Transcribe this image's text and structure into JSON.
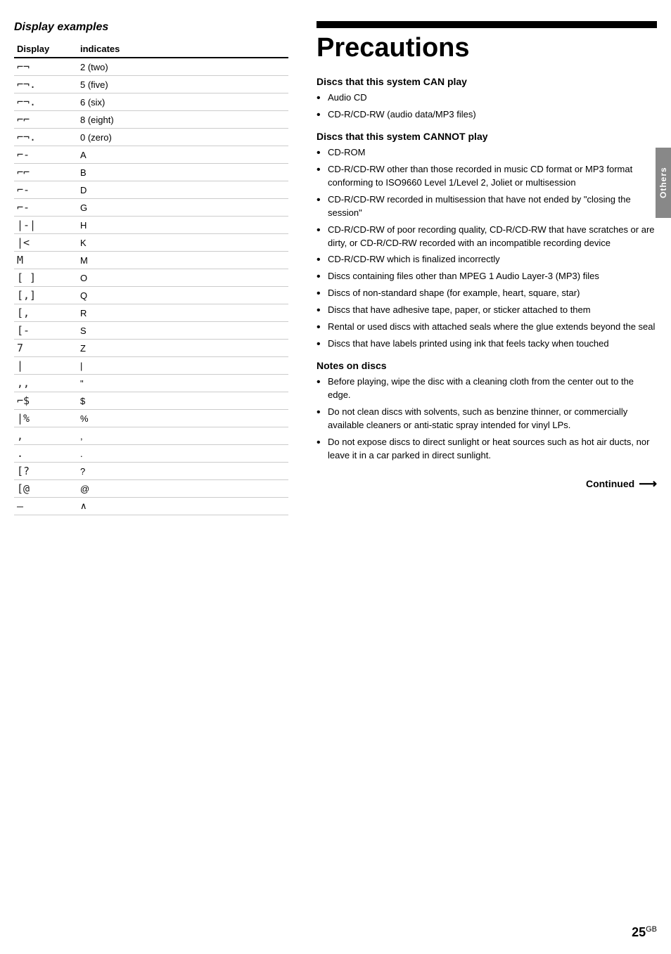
{
  "left": {
    "section_title": "Display examples",
    "table": {
      "col1": "Display",
      "col2": "indicates",
      "rows": [
        {
          "display": "⌐¬",
          "indicates": "2 (two)"
        },
        {
          "display": "⌐¬.",
          "indicates": "5 (five)"
        },
        {
          "display": "⌐¬.",
          "indicates": "6 (six)"
        },
        {
          "display": "⌐⌐",
          "indicates": "8 (eight)"
        },
        {
          "display": "⌐¬.",
          "indicates": "0 (zero)"
        },
        {
          "display": "⌐-",
          "indicates": "A"
        },
        {
          "display": "⌐⌐",
          "indicates": "B"
        },
        {
          "display": "⌐-",
          "indicates": "D"
        },
        {
          "display": "⌐-",
          "indicates": "G"
        },
        {
          "display": "|-|",
          "indicates": "H"
        },
        {
          "display": "|<",
          "indicates": "K"
        },
        {
          "display": "M",
          "indicates": "M"
        },
        {
          "display": "[ ]",
          "indicates": "O"
        },
        {
          "display": "[,]",
          "indicates": "Q"
        },
        {
          "display": "[,",
          "indicates": "R"
        },
        {
          "display": "[-",
          "indicates": "S"
        },
        {
          "display": "7",
          "indicates": "Z"
        },
        {
          "display": "|",
          "indicates": "|"
        },
        {
          "display": ",,",
          "indicates": "\""
        },
        {
          "display": "⌐$",
          "indicates": "$"
        },
        {
          "display": "|%",
          "indicates": "%"
        },
        {
          "display": ",",
          "indicates": ","
        },
        {
          "display": ".",
          "indicates": "."
        },
        {
          "display": "[?",
          "indicates": "?"
        },
        {
          "display": "[@",
          "indicates": "@"
        },
        {
          "display": "—",
          "indicates": "∧"
        }
      ]
    }
  },
  "right": {
    "top_bar": true,
    "page_title": "Precautions",
    "can_play": {
      "heading": "Discs that this system CAN play",
      "items": [
        "Audio CD",
        "CD-R/CD-RW (audio data/MP3 files)"
      ]
    },
    "cannot_play": {
      "heading": "Discs that this system CANNOT play",
      "items": [
        "CD-ROM",
        "CD-R/CD-RW other than those recorded in music CD format or MP3 format conforming to ISO9660 Level 1/Level 2, Joliet or multisession",
        "CD-R/CD-RW recorded in multisession that have not ended by \"closing the session\"",
        "CD-R/CD-RW of poor recording quality, CD-R/CD-RW that have scratches or are dirty, or CD-R/CD-RW recorded with an incompatible recording device",
        "CD-R/CD-RW which is finalized incorrectly",
        "Discs containing files other than MPEG 1 Audio Layer-3 (MP3) files",
        "Discs of non-standard shape (for example, heart, square, star)",
        "Discs that have adhesive tape, paper, or sticker attached to them",
        "Rental or used discs with attached seals where the glue extends beyond the seal",
        "Discs that have labels printed using ink that feels tacky when touched"
      ]
    },
    "notes_on_discs": {
      "heading": "Notes on discs",
      "items": [
        "Before playing, wipe the disc with a cleaning cloth from the center out to the edge.",
        "Do not clean discs with solvents, such as benzine thinner, or commercially available cleaners or anti-static spray intended for vinyl LPs.",
        "Do not expose discs to direct sunlight or heat sources such as hot air ducts, nor leave it in a car parked in direct sunlight."
      ]
    },
    "continued_label": "Continued",
    "others_tab_label": "Others",
    "page_number": "25",
    "page_number_suffix": "GB"
  }
}
